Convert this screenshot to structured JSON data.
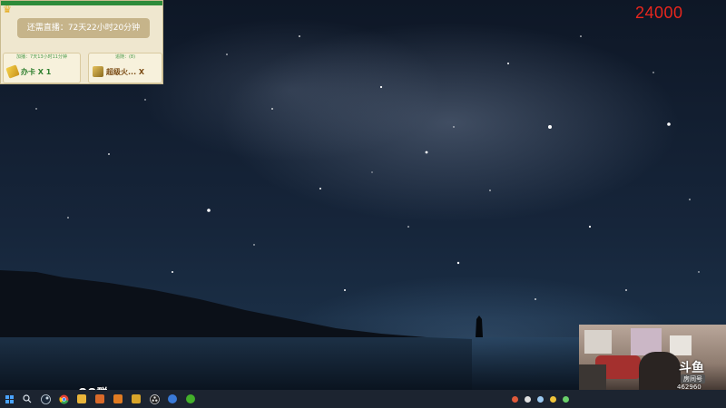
{
  "live_panel": {
    "countdown": "还需直播：72天22小时20分钟",
    "cards": [
      {
        "header": "加播：7天13小时11分钟",
        "label": "办卡 X 1"
      },
      {
        "header": "追随：(8)",
        "label": "超级火... X"
      }
    ]
  },
  "score": "24000",
  "desktop": {
    "qq_label": "QQ群"
  },
  "webcam": {
    "logo_text": "斗鱼",
    "room_label": "房间号",
    "room_number": "462960"
  },
  "taskbar": {
    "apps": [
      {
        "icon": "windows-start-icon"
      },
      {
        "icon": "search-icon"
      },
      {
        "icon": "steam-icon"
      },
      {
        "icon": "chrome-icon",
        "color": "#e34133"
      },
      {
        "icon": "folder-icon",
        "color": "#e8b43a"
      },
      {
        "icon": "game-app-icon",
        "color": "#d96a2a"
      },
      {
        "icon": "game-app-icon",
        "color": "#e07b22"
      },
      {
        "icon": "game-app-icon",
        "color": "#d9a52a"
      },
      {
        "icon": "obs-icon",
        "color": "#222222"
      },
      {
        "icon": "network-app-icon",
        "color": "#3a7ad8"
      },
      {
        "icon": "wechat-icon",
        "color": "#43b02a"
      }
    ]
  },
  "colors": {
    "panel_green": "#2e8b3a",
    "score_red": "#e8261d"
  }
}
